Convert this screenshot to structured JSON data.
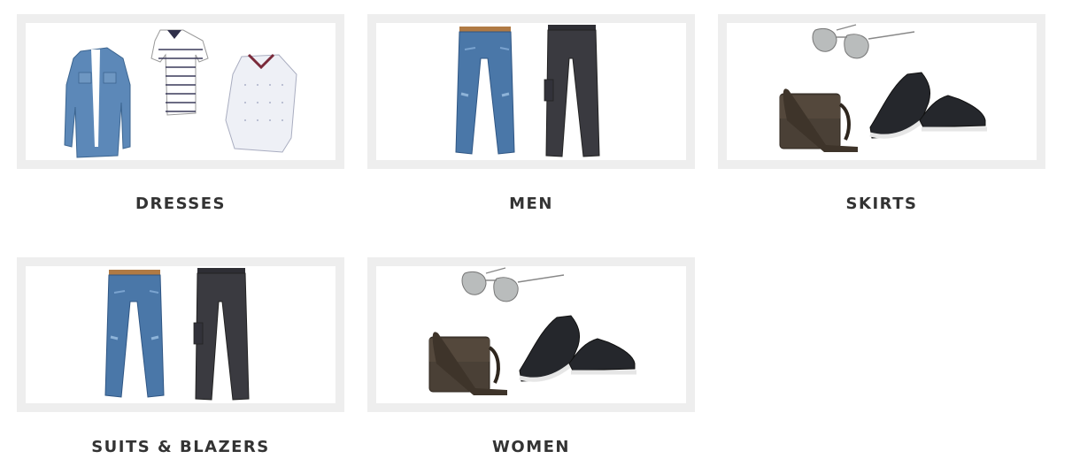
{
  "categories": [
    {
      "label": "DRESSES",
      "image": "shirts-and-denim-jacket"
    },
    {
      "label": "MEN",
      "image": "jeans-and-trousers"
    },
    {
      "label": "SKIRTS",
      "image": "sunglasses-bag-and-shoes"
    },
    {
      "label": "SUITS & BLAZERS",
      "image": "jeans-and-trousers"
    },
    {
      "label": "WOMEN",
      "image": "sunglasses-bag-and-shoes"
    }
  ],
  "colors": {
    "frame": "#eeeeee",
    "label": "#333333",
    "denim": "#4a77a8",
    "charcoal": "#3a3a40",
    "leather": "#4a4036"
  }
}
